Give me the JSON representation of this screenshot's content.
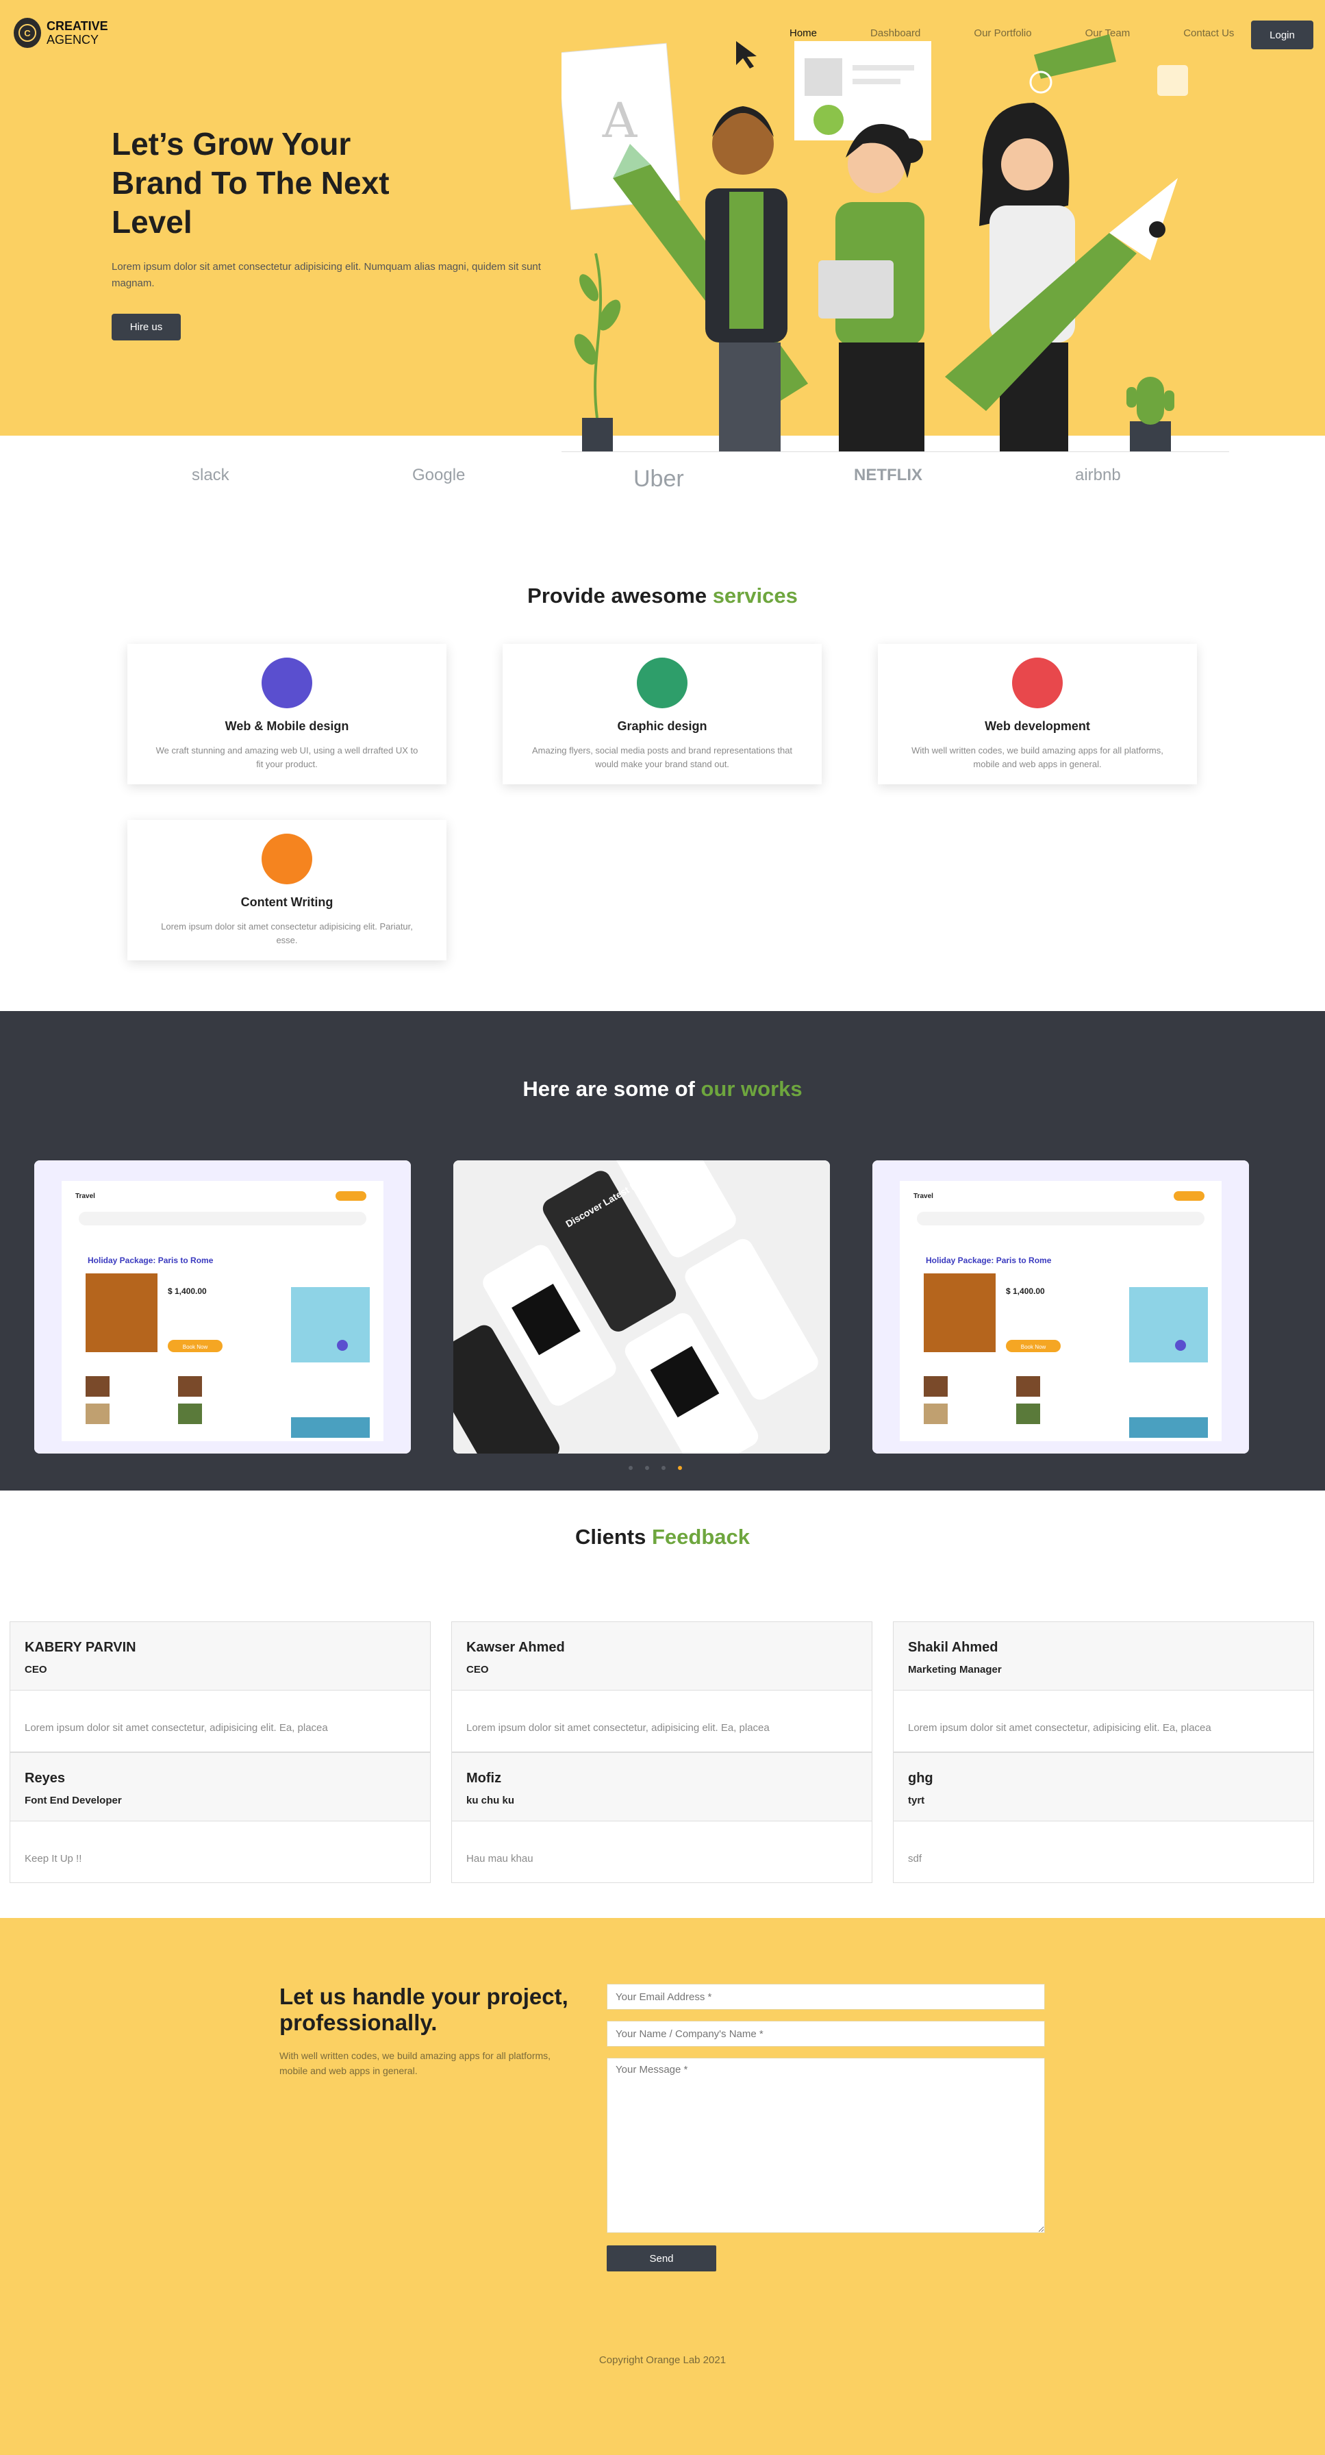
{
  "header": {
    "logo_line1": "CREATIVE",
    "logo_line2": "AGENCY",
    "nav": [
      "Home",
      "Dashboard",
      "Our Portfolio",
      "Our Team",
      "Contact Us"
    ],
    "login_label": "Login"
  },
  "hero": {
    "title": "Let’s Grow Your Brand To The Next Level",
    "description": "Lorem ipsum dolor sit amet consectetur adipisicing elit. Numquam alias magni, quidem sit sunt magnam.",
    "cta": "Hire us"
  },
  "brands": [
    "slack",
    "Google",
    "Uber",
    "NETFLIX",
    "airbnb"
  ],
  "services": {
    "title_prefix": "Provide awesome ",
    "title_highlight": "services",
    "items": [
      {
        "title": "Web & Mobile design",
        "desc": "We craft stunning and amazing web UI, using a well drrafted UX to fit your product.",
        "icon_color": "#5a4fcf"
      },
      {
        "title": "Graphic design",
        "desc": "Amazing flyers, social media posts and brand representations that would make your brand stand out.",
        "icon_color": "#2e9e6a"
      },
      {
        "title": "Web development",
        "desc": "With well written codes, we build amazing apps for all platforms, mobile and web apps in general.",
        "icon_color": "#e8484c"
      },
      {
        "title": "Content Writing",
        "desc": "Lorem ipsum dolor sit amet consectetur adipisicing elit. Pariatur, esse.",
        "icon_color": "#f5841f"
      }
    ]
  },
  "works": {
    "title_prefix": "Here are some of ",
    "title_highlight": "our works",
    "cards": [
      {
        "brand": "Travel",
        "headline": "Holiday Package: Paris to Rome",
        "price": "$ 1,400.00",
        "cta": "Book Now"
      },
      {
        "brand": "",
        "headline": "Discover Latest Book",
        "price": "",
        "cta": ""
      },
      {
        "brand": "Travel",
        "headline": "Holiday Package: Paris to Rome",
        "price": "$ 1,400.00",
        "cta": "Book Now"
      }
    ]
  },
  "feedback": {
    "title_prefix": "Clients ",
    "title_highlight": "Feedback",
    "items": [
      {
        "name": "KABERY PARVIN",
        "role": "CEO",
        "text": "Lorem ipsum dolor sit amet consectetur, adipisicing elit. Ea, placea"
      },
      {
        "name": "Kawser Ahmed",
        "role": "CEO",
        "text": "Lorem ipsum dolor sit amet consectetur, adipisicing elit. Ea, placea"
      },
      {
        "name": "Shakil Ahmed",
        "role": "Marketing Manager",
        "text": "Lorem ipsum dolor sit amet consectetur, adipisicing elit. Ea, placea"
      },
      {
        "name": "Reyes",
        "role": "Font End Developer",
        "text": "Keep It Up !!"
      },
      {
        "name": "Mofiz",
        "role": "ku chu ku",
        "text": "Hau mau khau"
      },
      {
        "name": "ghg",
        "role": "tyrt",
        "text": "sdf"
      }
    ]
  },
  "contact": {
    "title": "Let us handle your project, professionally.",
    "description": "With well written codes, we build amazing apps for all platforms, mobile and web apps in general.",
    "email_placeholder": "Your Email Address *",
    "name_placeholder": "Your Name / Company's Name *",
    "message_placeholder": "Your Message *",
    "send_label": "Send",
    "copyright": "Copyright Orange Lab 2021"
  },
  "colors": {
    "accent_yellow": "#fbd062",
    "accent_green": "#6ea63e",
    "dark": "#3a4049"
  }
}
